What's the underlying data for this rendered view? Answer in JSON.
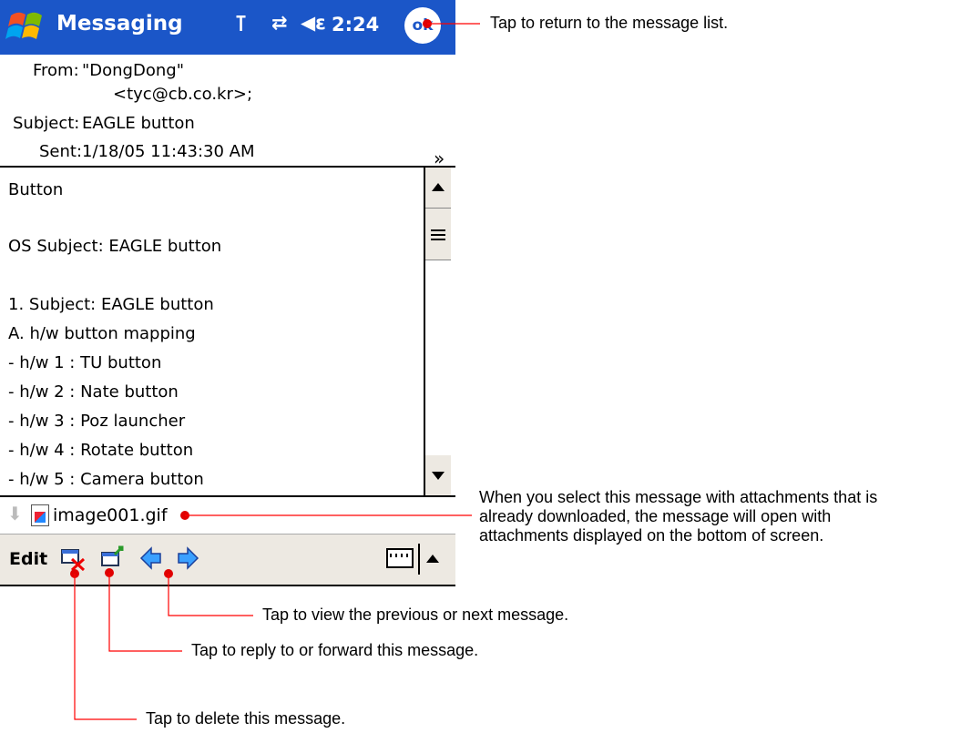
{
  "titlebar": {
    "app_title": "Messaging",
    "clock": "2:24",
    "ok_label": "ok",
    "signal_icon": "antenna-icon",
    "connection_icon": "connectivity-icon",
    "volume_icon": "speaker-icon",
    "start_icon": "windows-start-icon"
  },
  "header": {
    "from_label": "From:",
    "from_name": "\"DongDong\"",
    "from_email": "<tyc@cb.co.kr>;",
    "subject_label": "Subject:",
    "subject_value": "EAGLE button",
    "sent_label": "Sent:",
    "sent_value": "1/18/05 11:43:30 AM",
    "expand_icon": "double-chevron-down-icon"
  },
  "body_lines": [
    "Button",
    "OS  Subject: EAGLE button",
    "1. Subject: EAGLE button",
    "A. h/w button mapping",
    "- h/w 1 : TU button",
    "- h/w 2 : Nate button",
    "- h/w 3 : Poz launcher",
    "- h/w 4 : Rotate button",
    "- h/w 5 : Camera button"
  ],
  "attachment": {
    "name": "image001.gif",
    "download_icon": "download-arrow-icon",
    "file_icon": "image-file-icon"
  },
  "menubar": {
    "edit_label": "Edit",
    "delete_icon": "delete-message-icon",
    "reply_icon": "reply-forward-icon",
    "prev_icon": "previous-arrow-icon",
    "next_icon": "next-arrow-icon",
    "keyboard_icon": "keyboard-icon",
    "sip_icon": "input-panel-arrow-icon"
  },
  "annotations": {
    "ok": "Tap to return to the message list.",
    "attachment": "When you select this message with attachments that is already downloaded, the message will open with attachments displayed on the bottom of screen.",
    "navigate": "Tap to view the previous or next message.",
    "reply": "Tap to reply to or forward this message.",
    "delete": "Tap to delete this message."
  },
  "colors": {
    "titlebar": "#1b56c8",
    "menubar": "#ede9e2",
    "callout_line": "#ff0000",
    "callout_dot": "#e00000"
  }
}
